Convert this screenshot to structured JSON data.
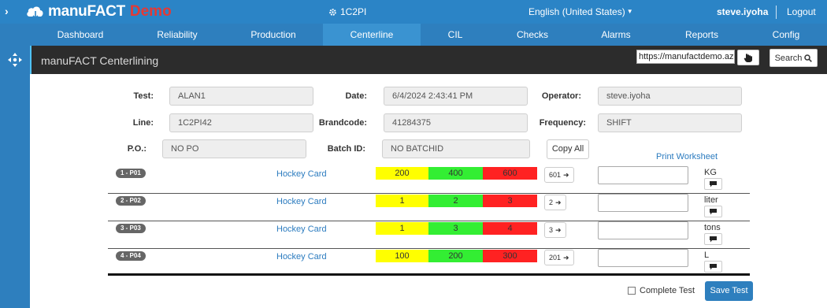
{
  "header": {
    "brand": "manuFACT",
    "env": "Demo",
    "plant": "1C2PI",
    "language": "English (United States)",
    "user": "steve.iyoha",
    "logout": "Logout"
  },
  "nav": {
    "items": [
      {
        "label": "Dashboard"
      },
      {
        "label": "Reliability"
      },
      {
        "label": "Production"
      },
      {
        "label": "Centerline"
      },
      {
        "label": "CIL"
      },
      {
        "label": "Checks"
      },
      {
        "label": "Alarms"
      },
      {
        "label": "Reports"
      },
      {
        "label": "Config"
      }
    ],
    "active": "Centerline"
  },
  "toolbar": {
    "title": "manuFACT Centerlining",
    "url_value": "https://manufactdemo.azure",
    "search_label": "Search"
  },
  "form": {
    "test_label": "Test:",
    "test_value": "ALAN1",
    "date_label": "Date:",
    "date_value": "6/4/2024 2:43:41 PM",
    "operator_label": "Operator:",
    "operator_value": "steve.iyoha",
    "line_label": "Line:",
    "line_value": "1C2PI42",
    "brandcode_label": "Brandcode:",
    "brandcode_value": "41284375",
    "frequency_label": "Frequency:",
    "frequency_value": "SHIFT",
    "po_label": "P.O.:",
    "po_value": "NO PO",
    "batch_label": "Batch ID:",
    "batch_value": "NO BATCHID",
    "copy_all": "Copy All",
    "print_worksheet": "Print Worksheet"
  },
  "rows": [
    {
      "badge": "1 - P01",
      "name": "Hockey Card",
      "low": "200",
      "target": "400",
      "high": "600",
      "copy": "601",
      "unit": "KG"
    },
    {
      "badge": "2 - P02",
      "name": "Hockey Card",
      "low": "1",
      "target": "2",
      "high": "3",
      "copy": "2",
      "unit": "liter"
    },
    {
      "badge": "3 - P03",
      "name": "Hockey Card",
      "low": "1",
      "target": "3",
      "high": "4",
      "copy": "3",
      "unit": "tons"
    },
    {
      "badge": "4 - P04",
      "name": "Hockey Card",
      "low": "100",
      "target": "200",
      "high": "300",
      "copy": "201",
      "unit": "L"
    }
  ],
  "footer": {
    "complete_label": "Complete Test",
    "save_label": "Save Test"
  },
  "colors": {
    "header_blue": "#2b84c6",
    "nav_blue": "#2e7fbe",
    "accent_red": "#e53935",
    "range_yellow": "#ffff00",
    "range_green": "#33ee33",
    "range_red": "#ff2222"
  },
  "icons": {
    "chevron": "chevron-right-icon",
    "cloud": "cloud-logo-icon",
    "gear": "gear-icon",
    "move": "move-arrows-icon",
    "hand": "hand-pointer-icon",
    "search": "search-icon",
    "arrow": "arrow-right-icon",
    "comment": "comment-icon"
  }
}
